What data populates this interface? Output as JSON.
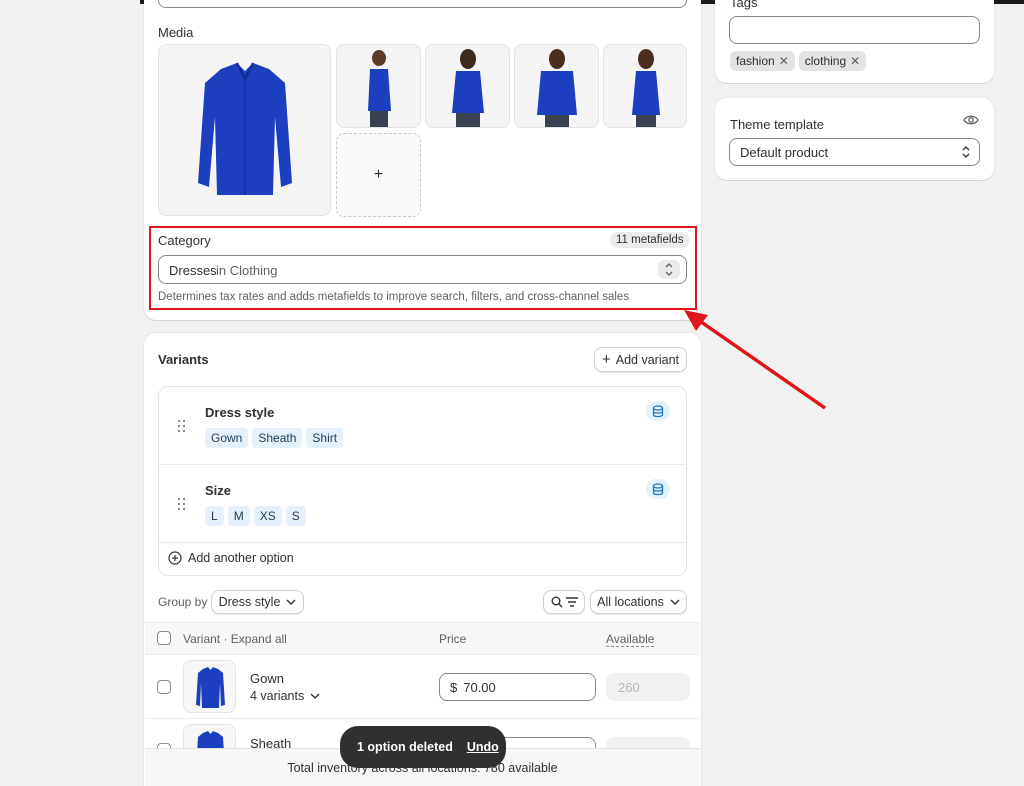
{
  "media": {
    "title": "Media",
    "add_symbol": "+"
  },
  "category": {
    "label": "Category",
    "metafields_badge": "11 metafields",
    "selected_primary": "Dresses",
    "selected_secondary": "in Clothing",
    "help_text": "Determines tax rates and adds metafields to improve search, filters, and cross-channel sales"
  },
  "tags": {
    "label": "Tags",
    "input_value": "",
    "items": [
      {
        "label": "fashion"
      },
      {
        "label": "clothing"
      }
    ]
  },
  "theme_template": {
    "label": "Theme template",
    "selected": "Default product"
  },
  "variants": {
    "title": "Variants",
    "add_variant_label": "Add variant",
    "options": [
      {
        "name": "Dress style",
        "values": [
          "Gown",
          "Sheath",
          "Shirt"
        ]
      },
      {
        "name": "Size",
        "values": [
          "L",
          "M",
          "XS",
          "S"
        ]
      }
    ],
    "add_option_label": "Add another option",
    "group_by_label": "Group by",
    "group_by_value": "Dress style",
    "locations_value": "All locations",
    "table": {
      "col_variant": "Variant · Expand all",
      "col_price": "Price",
      "col_available": "Available",
      "rows": [
        {
          "name": "Gown",
          "sub": "4 variants",
          "currency": "$",
          "price": "70.00",
          "available": "260"
        },
        {
          "name": "Sheath",
          "sub": "",
          "currency": "$",
          "price": "",
          "available": ""
        }
      ]
    },
    "footer_text": "Total inventory across all locations: 780 available"
  },
  "toast": {
    "message": "1 option deleted",
    "action": "Undo"
  },
  "colors": {
    "highlight": "#e0141b",
    "product": "#1c3fbf"
  }
}
